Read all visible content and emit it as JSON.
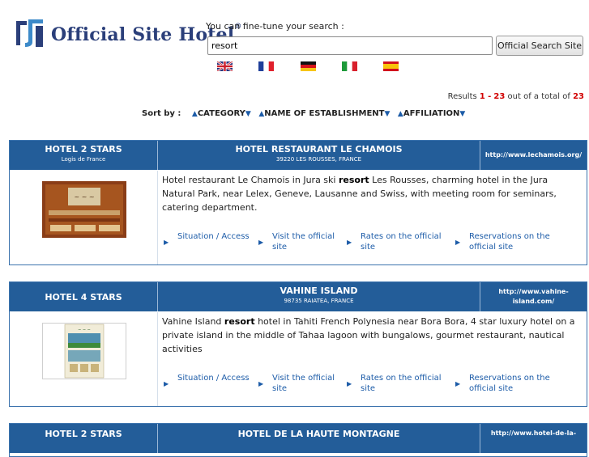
{
  "header": {
    "brand": "Official Site Hotel",
    "reg_mark": "®",
    "tune_label": "You can fine-tune your search :",
    "search_value": "resort",
    "search_button": "Official Search Site",
    "flags": [
      "flag-uk-icon",
      "flag-france-icon",
      "flag-germany-icon",
      "flag-italy-icon",
      "flag-spain-icon"
    ]
  },
  "results": {
    "prefix": "Results",
    "from": "1",
    "dash": "-",
    "to": "23",
    "middle": "out of a total of",
    "total": "23"
  },
  "sort": {
    "label": "Sort by :",
    "items": [
      "CATEGORY",
      "NAME OF ESTABLISHMENT",
      "AFFILIATION"
    ]
  },
  "colors": {
    "header_blue": "#235d99",
    "link_blue": "#1d5ca8",
    "result_red": "#d10000",
    "brand_navy": "#2b3f7a"
  },
  "hotels": [
    {
      "category": "HOTEL 2 STARS",
      "affiliation": "Logis de France",
      "name": "HOTEL RESTAURANT LE CHAMOIS",
      "location": "39220 LES ROUSSES, FRANCE",
      "url": "http://www.lechamois.org/",
      "desc_before": "Hotel restaurant Le Chamois in Jura ski ",
      "desc_keyword": "resort",
      "desc_after": " Les Rousses, charming hotel in the Jura Natural Park, near Lelex, Geneve, Lausanne and Swiss, with meeting room for seminars, catering department.",
      "links": [
        "Situation / Access",
        "Visit the official site",
        "Rates on the official site",
        "Reservations on the official site"
      ]
    },
    {
      "category": "HOTEL 4 STARS",
      "affiliation": "",
      "name": "VAHINE ISLAND",
      "location": "98735 RAIATEA, FRANCE",
      "url": "http://www.vahine-island.com/",
      "desc_before": "Vahine Island ",
      "desc_keyword": "resort",
      "desc_after": " hotel in Tahiti French Polynesia near Bora Bora, 4 star luxury hotel on a private island in the middle of Tahaa lagoon with bungalows, gourmet restaurant, nautical activities",
      "links": [
        "Situation / Access",
        "Visit the official site",
        "Rates on the official site",
        "Reservations on the official site"
      ]
    },
    {
      "category": "HOTEL 2 STARS",
      "affiliation": "",
      "name": "HOTEL DE LA HAUTE MONTAGNE",
      "location": "",
      "url": "http://www.hotel-de-la-",
      "desc_before": "",
      "desc_keyword": "",
      "desc_after": "",
      "links": []
    }
  ]
}
